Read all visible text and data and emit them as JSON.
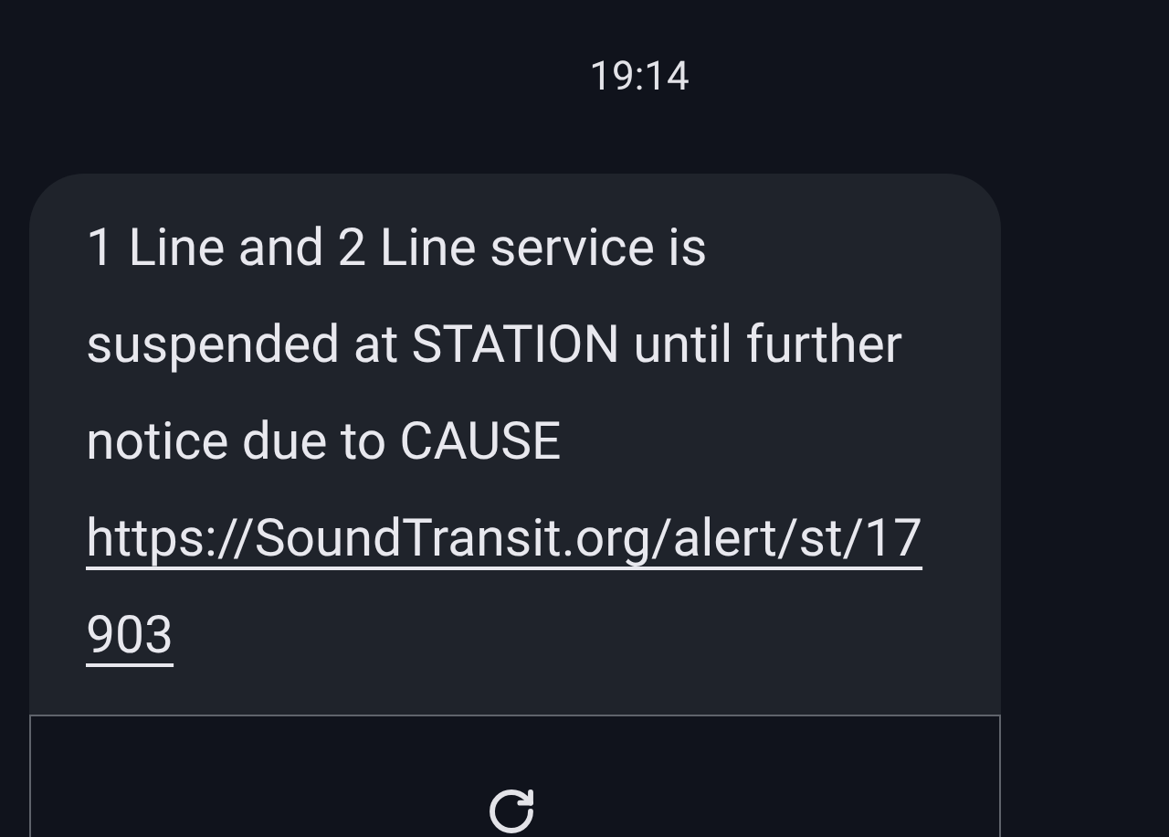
{
  "time": "19:14",
  "message": {
    "text": "1 Line and 2 Line service is suspended at STATION until further notice due to CAUSE",
    "link": "https://SoundTransit.org/alert/st/17903"
  }
}
